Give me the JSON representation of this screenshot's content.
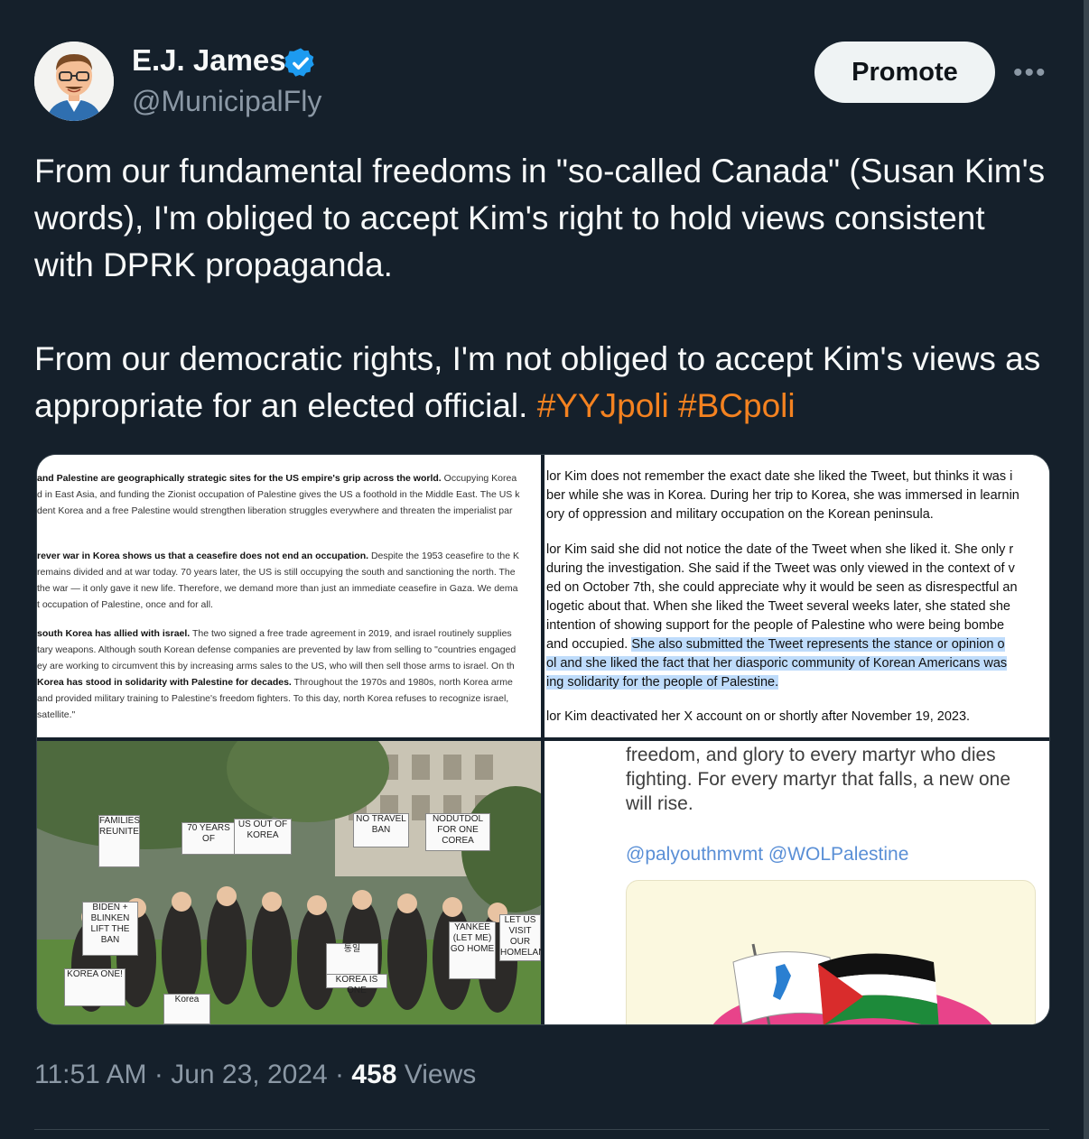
{
  "author": {
    "display_name": "E.J. James",
    "handle": "@MunicipalFly",
    "verified": true,
    "avatar_icon": "cartoon-avatar-icon"
  },
  "actions": {
    "promote_label": "Promote",
    "more_label": "•••"
  },
  "tweet": {
    "paragraph1": "From our fundamental freedoms in \"so-called Canada\" (Susan Kim's words), I'm obliged to accept Kim's right to hold views consistent with DPRK propaganda.",
    "paragraph2_text": "From our democratic rights, I'm not obliged to accept Kim's views as appropriate for an elected official.",
    "hashtags": [
      "#YYJpoli",
      "#BCpoli"
    ]
  },
  "media": {
    "panel1_lines": [
      {
        "bold": "and Palestine are geographically strategic sites for the US empire's grip across the world.",
        "text": " Occupying Korea"
      },
      {
        "bold": "",
        "text": "d in East Asia, and funding the Zionist occupation of Palestine gives the US a foothold in the Middle East. The US k"
      },
      {
        "bold": "",
        "text": "dent Korea and a free Palestine would strengthen liberation struggles everywhere and threaten the imperialist par"
      },
      {
        "bold": "rever war in Korea shows us that a ceasefire does not end an occupation.",
        "text": " Despite the 1953 ceasefire to the K"
      },
      {
        "bold": "",
        "text": "remains divided and at war today. 70 years later, the US is still occupying the south and sanctioning the north. The"
      },
      {
        "bold": "",
        "text": "the war — it only gave it new life. Therefore, we demand more than just an immediate ceasefire in Gaza. We dema"
      },
      {
        "bold": "",
        "text": "t occupation of Palestine, once and for all."
      },
      {
        "bold": "south Korea has allied with israel.",
        "text": " The two signed a free trade agreement in 2019, and israel routinely supplies"
      },
      {
        "bold": "",
        "text": "tary weapons. Although south Korean defense companies are prevented by law from selling to \"countries engaged"
      },
      {
        "bold": "",
        "text": "ey are working to circumvent this by increasing arms sales to the US, who will then sell those arms to israel. On th"
      },
      {
        "bold": "Korea has stood in solidarity with Palestine for decades.",
        "text": " Throughout the 1970s and 1980s, north Korea arme"
      },
      {
        "bold": "",
        "text": "and provided military training to Palestine's freedom fighters. To this day, north Korea refuses to recognize israel,"
      },
      {
        "bold": "",
        "text": "satellite.\""
      }
    ],
    "panel2_lines": [
      {
        "text": "lor Kim does not remember the exact date she liked the Tweet, but thinks it was i",
        "hl": ""
      },
      {
        "text": "ber while she was in Korea. During her trip to Korea, she was immersed in learnin",
        "hl": ""
      },
      {
        "text": "ory of oppression and military occupation on the Korean peninsula.",
        "hl": ""
      },
      {
        "text": "lor Kim said she did not notice the date of the Tweet when she liked it. She only r",
        "hl": ""
      },
      {
        "text": " during the investigation. She said if the Tweet was only viewed in the context of v",
        "hl": ""
      },
      {
        "text": "ed on October 7th, she could appreciate why it would be seen as disrespectful an",
        "hl": ""
      },
      {
        "text": "logetic about that. When she liked the Tweet several weeks later, she stated she ",
        "hl": ""
      },
      {
        "text": " intention of showing support for the people of Palestine who were being bombe",
        "hl": ""
      },
      {
        "text": " and occupied. ",
        "hl": "She also submitted the Tweet represents the stance or opinion o"
      },
      {
        "text": "",
        "hl": "ol and she liked the fact that her diasporic community of Korean Americans was"
      },
      {
        "text": "",
        "hl": "ing solidarity for the people of Palestine."
      },
      {
        "text": "lor Kim deactivated her X account on or shortly after November 19, 2023.",
        "hl": ""
      }
    ],
    "panel3_signs": [
      "70 YEARS OF",
      "US OUT OF KOREA",
      "NO TRAVEL BAN",
      "NODUTDOL FOR ONE COREA",
      "BIDEN + BLINKEN LIFT THE BAN",
      "YANKEE (LET ME) GO HOME",
      "통일",
      "KOREA IS ONE",
      "KOREA ONE!",
      "Korea",
      "LET US VISIT OUR HOMELAND",
      "FAMILIES REUNITE"
    ],
    "panel4_lines": [
      "freedom, and glory to every martyr who dies",
      "fighting. For every martyr that falls, a new one",
      "will rise."
    ],
    "panel4_mentions": "@palyouthmvmt @WOLPalestine"
  },
  "meta": {
    "time": "11:51 AM",
    "separator": "·",
    "date": "Jun 23, 2024",
    "views_count": "458",
    "views_label": "Views"
  },
  "colors": {
    "background": "#15202b",
    "text": "#f7f9f9",
    "muted": "#8b98a5",
    "hashtag": "#f48220",
    "verified": "#1d9bf0",
    "promote_bg": "#eff3f4"
  }
}
